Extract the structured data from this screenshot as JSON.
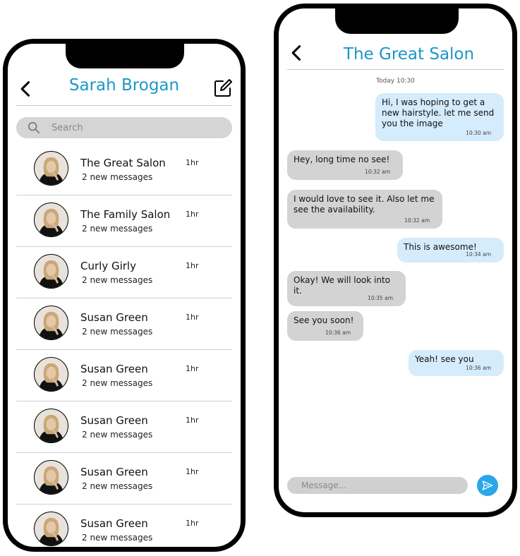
{
  "contacts_screen": {
    "title": "Sarah Brogan",
    "back_icon": "chevron-left-icon",
    "compose_icon": "edit-icon",
    "search_placeholder": "Search",
    "accent": "#1b97c9",
    "conversations": [
      {
        "name": "The Great Salon",
        "preview": "2 new messages",
        "time": "1hr"
      },
      {
        "name": "The Family Salon",
        "preview": "2 new messages",
        "time": "1hr"
      },
      {
        "name": "Curly Girly",
        "preview": "2 new messages",
        "time": "1hr"
      },
      {
        "name": "Susan Green",
        "preview": "2 new messages",
        "time": "1hr"
      },
      {
        "name": "Susan Green",
        "preview": "2 new messages",
        "time": "1hr"
      },
      {
        "name": "Susan Green",
        "preview": "2 new messages",
        "time": "1hr"
      },
      {
        "name": "Susan Green",
        "preview": "2 new messages",
        "time": "1hr"
      },
      {
        "name": "Susan Green",
        "preview": "2 new messages",
        "time": "1hr"
      }
    ]
  },
  "chat_screen": {
    "title": "The Great Salon",
    "back_icon": "chevron-left-icon",
    "date_separator": "Today 10:30",
    "message_placeholder": "Message...",
    "send_icon": "send-icon",
    "incoming_bubble_color": "#d3d3d3",
    "outgoing_bubble_color": "#d4ecfb",
    "messages": [
      {
        "direction": "out",
        "text": "Hi, I was hoping to get a new hairstyle. let me send you the image",
        "time": "10:30 am"
      },
      {
        "direction": "in",
        "text": "Hey, long time no see!",
        "time": "10:32 am"
      },
      {
        "direction": "in",
        "text": "I would love to see it. Also let me see the availability.",
        "time": "10:32 am"
      },
      {
        "direction": "out",
        "text": "This is awesome!",
        "time": "10:34 am"
      },
      {
        "direction": "in",
        "text": "Okay! We will look into it.",
        "time": "10:35 am"
      },
      {
        "direction": "in",
        "text": "See you soon!",
        "time": "10:36 am"
      },
      {
        "direction": "out",
        "text": "Yeah! see you",
        "time": "10:36 am"
      }
    ]
  }
}
